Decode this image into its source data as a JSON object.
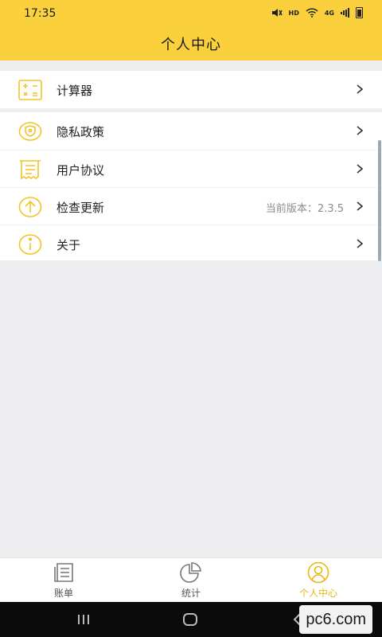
{
  "status_bar": {
    "time": "17:35",
    "hd": "HD",
    "net": "4G"
  },
  "header": {
    "title": "个人中心"
  },
  "menu_group_1": [
    {
      "label": "计算器",
      "icon": "calculator-icon"
    }
  ],
  "menu_group_2": [
    {
      "label": "隐私政策",
      "icon": "shield-icon"
    },
    {
      "label": "用户协议",
      "icon": "document-icon"
    },
    {
      "label": "检查更新",
      "icon": "upload-icon",
      "value": "当前版本：2.3.5"
    },
    {
      "label": "关于",
      "icon": "info-icon"
    }
  ],
  "tabs": [
    {
      "label": "账单",
      "icon": "bill-icon",
      "active": false
    },
    {
      "label": "统计",
      "icon": "pie-chart-icon",
      "active": false
    },
    {
      "label": "个人中心",
      "icon": "user-icon",
      "active": true
    }
  ],
  "watermark": {
    "text": "pc6.com"
  },
  "colors": {
    "accent": "#fad13d",
    "active_tab": "#e8b710",
    "icon_stroke": "#f2c425"
  }
}
